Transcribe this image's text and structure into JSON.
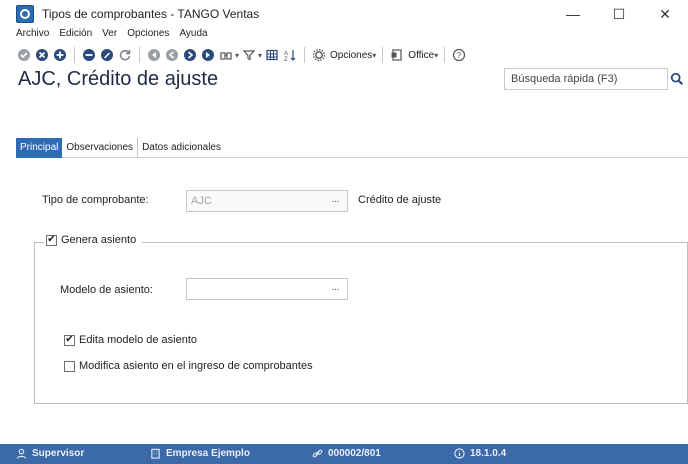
{
  "window": {
    "title": "Tipos de comprobantes - TANGO Ventas",
    "minimize": "—",
    "maximize": "☐",
    "close": "✕"
  },
  "menu": [
    "Archivo",
    "Edición",
    "Ver",
    "Opciones",
    "Ayuda"
  ],
  "toolbar": {
    "opciones_label": "Opciones",
    "office_label": "Office"
  },
  "header": {
    "title": "AJC, Crédito de ajuste"
  },
  "search": {
    "placeholder": "Búsqueda rápida (F3)"
  },
  "tabs": [
    "Principal",
    "Observaciones",
    "Datos adicionales"
  ],
  "form": {
    "tipo_label": "Tipo de comprobante:",
    "tipo_value": "AJC",
    "tipo_description": "Crédito de ajuste",
    "genera_asiento_label": "Genera asiento",
    "genera_asiento_checked": true,
    "modelo_label": "Modelo de asiento:",
    "modelo_value": "",
    "edita_modelo_label": "Edita modelo de asiento",
    "edita_modelo_checked": true,
    "modifica_asiento_label": "Modifica asiento en el ingreso de comprobantes",
    "modifica_asiento_checked": false,
    "ellipsis": "···"
  },
  "status": {
    "user": "Supervisor",
    "company": "Empresa Ejemplo",
    "code": "000002/801",
    "version": "18.1.0.4"
  },
  "colors": {
    "accent": "#2e6bb5",
    "statusbar": "#3c6aa8"
  }
}
